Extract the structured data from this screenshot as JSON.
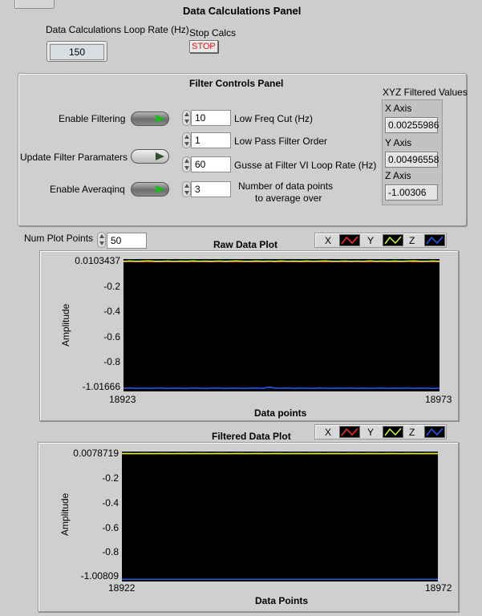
{
  "data_panel": {
    "title": "Data Calculations Panel",
    "loop_rate_label": "Data Calculations Loop Rate (Hz)",
    "loop_rate_value": "150",
    "stop_calcs_label": "Stop Calcs",
    "stop_button": "STOP"
  },
  "filter_panel": {
    "title": "Filter Controls Panel",
    "enable_filtering": "Enable Filtering",
    "enable_filtering_on": true,
    "update_filter": "Update Filter Paramaters",
    "update_filter_on": false,
    "enable_averaging": "Enable Averaqinq",
    "enable_averaging_on": true,
    "low_freq_cut_value": "10",
    "low_freq_cut_label": "Low Freq Cut (Hz)",
    "low_pass_order_value": "1",
    "low_pass_order_label": "Low Pass Filter Order",
    "guess_rate_value": "60",
    "guess_rate_label": "Gusse at Filter VI Loop Rate (Hz)",
    "avg_points_value": "3",
    "avg_points_label_1": "Number of data points",
    "avg_points_label_2": "to average over"
  },
  "xyz": {
    "title": "XYZ Filtered Values",
    "x_label": "X Axis",
    "x_value": "0.00255986",
    "y_label": "Y Axis",
    "y_value": "0.00496558",
    "z_label": "Z Axis",
    "z_value": "-1.00306"
  },
  "num_plot_points": {
    "label": "Num Plot Points",
    "value": "50"
  },
  "legend": {
    "x": "X",
    "y": "Y",
    "z": "Z"
  },
  "colors": {
    "x": "#ff2a2a",
    "y": "#c8ff3a",
    "z": "#1f5fff",
    "background": "#000000"
  },
  "chart_data": [
    {
      "type": "line",
      "title": "Raw Data Plot",
      "xlabel": "Data points",
      "ylabel": "Amplitude",
      "xlim": [
        18923,
        18973
      ],
      "ylim": [
        -1.01666,
        0.0103437
      ],
      "y_top_label": "0.0103437",
      "y_bottom_label": "-1.01666",
      "x_ticks": [
        "18923",
        "18973"
      ],
      "y_ticks": [
        "-0.2",
        "-0.4",
        "-0.6",
        "-0.8"
      ],
      "series": [
        {
          "name": "X",
          "values": [
            0.003,
            0.004,
            0.002,
            0.003,
            0.004,
            0.002,
            0.003,
            0.002,
            0.004,
            0.003,
            0.002,
            0.003,
            0.004,
            0.002,
            0.003,
            0.004,
            0.002,
            0.003,
            0.002,
            0.004,
            0.003,
            0.002,
            0.003,
            0.004,
            0.002,
            0.003,
            0.004,
            0.002,
            0.003,
            0.002,
            0.004,
            0.003,
            0.002,
            0.003,
            0.004,
            0.002,
            0.003,
            0.004,
            0.002,
            0.003,
            0.002,
            0.004,
            0.003,
            0.002,
            0.003,
            0.004,
            0.002,
            0.003,
            0.004,
            0.002,
            0.003
          ]
        },
        {
          "name": "Y",
          "values": [
            0.006,
            0.008,
            0.005,
            0.007,
            0.009,
            0.005,
            0.006,
            0.008,
            0.004,
            0.007,
            0.006,
            0.009,
            0.005,
            0.007,
            0.006,
            0.008,
            0.005,
            0.007,
            0.009,
            0.006,
            0.005,
            0.008,
            0.006,
            0.007,
            0.005,
            0.009,
            0.006,
            0.007,
            0.005,
            0.008,
            0.006,
            0.007,
            0.009,
            0.005,
            0.006,
            0.008,
            0.005,
            0.007,
            0.006,
            0.009,
            0.005,
            0.007,
            0.006,
            0.008,
            0.005,
            0.007,
            0.009,
            0.006,
            0.005,
            0.008,
            0.006
          ]
        },
        {
          "name": "Z",
          "values": [
            -1.004,
            -1.002,
            -1.005,
            -1.003,
            -1.006,
            -1.004,
            -1.002,
            -1.005,
            -1.003,
            -1.004,
            -1.006,
            -1.002,
            -1.004,
            -1.005,
            -1.003,
            -1.002,
            -1.005,
            -1.004,
            -1.003,
            -1.006,
            -1.004,
            -1.002,
            -1.005,
            -0.995,
            -1.003,
            -1.004,
            -1.002,
            -1.005,
            -1.003,
            -1.004,
            -1.006,
            -1.002,
            -1.004,
            -1.005,
            -1.003,
            -1.004,
            -1.002,
            -1.005,
            -1.003,
            -1.006,
            -1.004,
            -1.002,
            -1.005,
            -1.003,
            -1.004,
            -1.002,
            -1.005,
            -1.003,
            -1.004,
            -1.006,
            -1.004
          ]
        }
      ]
    },
    {
      "type": "line",
      "title": "Filtered Data Plot",
      "xlabel": "Data Points",
      "ylabel": "Amplitude",
      "xlim": [
        18922,
        18972
      ],
      "ylim": [
        -1.00809,
        0.0078719
      ],
      "y_top_label": "0.0078719",
      "y_bottom_label": "-1.00809",
      "x_ticks": [
        "18922",
        "18972"
      ],
      "y_ticks": [
        "-0.2",
        "-0.4",
        "-0.6",
        "-0.8"
      ],
      "series": [
        {
          "name": "X",
          "values": [
            0.0026,
            0.0026,
            0.0025,
            0.0026,
            0.0026,
            0.0025,
            0.0026,
            0.0026,
            0.0025,
            0.0026,
            0.0026,
            0.0025,
            0.0026,
            0.0026,
            0.0025,
            0.0026,
            0.0026,
            0.0025,
            0.0026,
            0.0026,
            0.0025,
            0.0026,
            0.0026,
            0.0025,
            0.0026,
            0.0026,
            0.0025,
            0.0026,
            0.0026,
            0.0025,
            0.0026,
            0.0026,
            0.0025,
            0.0026,
            0.0026,
            0.0025,
            0.0026,
            0.0026,
            0.0025,
            0.0026,
            0.0026,
            0.0025,
            0.0026,
            0.0026,
            0.0025,
            0.0026,
            0.0026,
            0.0025,
            0.0026,
            0.0026,
            0.0026
          ]
        },
        {
          "name": "Y",
          "values": [
            0.005,
            0.0052,
            0.0049,
            0.0051,
            0.005,
            0.0048,
            0.005,
            0.0052,
            0.0049,
            0.0051,
            0.005,
            0.0049,
            0.005,
            0.0052,
            0.0049,
            0.0051,
            0.005,
            0.0048,
            0.005,
            0.0052,
            0.0049,
            0.0051,
            0.005,
            0.0049,
            0.005,
            0.0052,
            0.0049,
            0.0051,
            0.005,
            0.0048,
            0.005,
            0.0052,
            0.0049,
            0.0051,
            0.005,
            0.0049,
            0.005,
            0.0052,
            0.0049,
            0.0051,
            0.005,
            0.0048,
            0.005,
            0.0052,
            0.0049,
            0.0051,
            0.005,
            0.0049,
            0.005,
            0.0052,
            0.005
          ]
        },
        {
          "name": "Z",
          "values": [
            -1.003,
            -1.0031,
            -1.003,
            -1.0032,
            -1.0031,
            -1.003,
            -1.0031,
            -1.0032,
            -1.003,
            -1.0031,
            -1.003,
            -1.0032,
            -1.0031,
            -1.003,
            -1.0031,
            -1.0032,
            -1.003,
            -1.0031,
            -1.003,
            -1.0032,
            -1.0031,
            -1.003,
            -1.0031,
            -1.0032,
            -1.003,
            -1.0031,
            -1.003,
            -1.0032,
            -1.0031,
            -1.003,
            -1.0031,
            -1.0032,
            -1.003,
            -1.0031,
            -1.003,
            -1.0032,
            -1.0031,
            -1.003,
            -1.0031,
            -1.0032,
            -1.003,
            -1.0031,
            -1.003,
            -1.0032,
            -1.0031,
            -1.003,
            -1.0031,
            -1.0032,
            -1.003,
            -1.0031,
            -1.0031
          ]
        }
      ]
    }
  ]
}
